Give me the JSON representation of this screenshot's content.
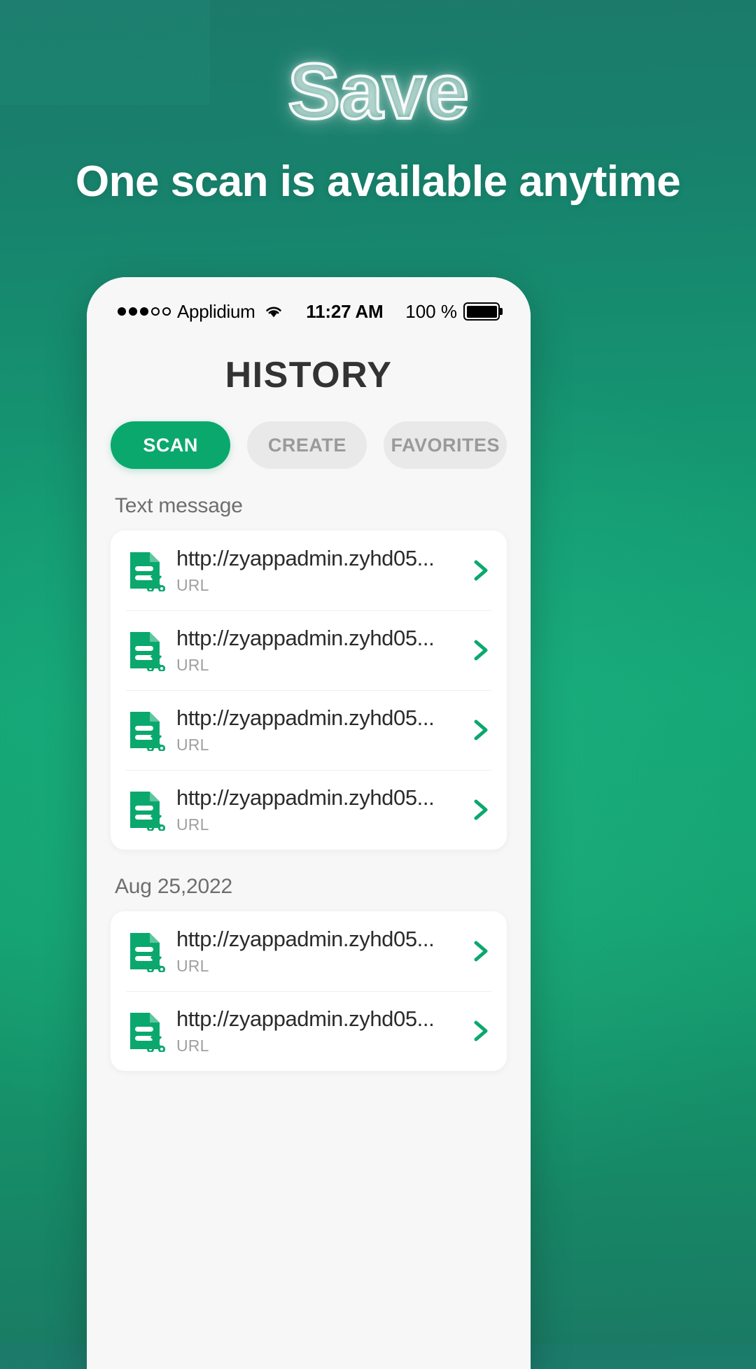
{
  "hero": {
    "title": "Save",
    "subtitle": "One scan is available anytime"
  },
  "colors": {
    "accent_green": "#0ba86e",
    "background_top": "#1c7a6b",
    "background_mid": "#13a474",
    "tab_inactive_bg": "#e9e9e9",
    "tab_inactive_text": "#9a9a9a",
    "screen_bg": "#f7f7f7",
    "title_text": "#333333"
  },
  "phone": {
    "status_bar": {
      "signal_dots_filled": 3,
      "signal_dots_empty": 2,
      "carrier": "Applidium",
      "wifi_icon": "wifi-icon",
      "time": "11:27 AM",
      "battery_percent": "100 %",
      "battery_icon": "battery-full-icon"
    },
    "nav_title": "HISTORY",
    "tabs": [
      {
        "label": "SCAN",
        "active": true
      },
      {
        "label": "CREATE",
        "active": false
      },
      {
        "label": "FAVORITES",
        "active": false
      }
    ],
    "sections": [
      {
        "header": "Text message",
        "items": [
          {
            "title": "http://zyappadmin.zyhd05...",
            "subtitle": "URL",
            "icon": "document-scissors-icon",
            "chevron": "chevron-right-icon"
          },
          {
            "title": "http://zyappadmin.zyhd05...",
            "subtitle": "URL",
            "icon": "document-scissors-icon",
            "chevron": "chevron-right-icon"
          },
          {
            "title": "http://zyappadmin.zyhd05...",
            "subtitle": "URL",
            "icon": "document-scissors-icon",
            "chevron": "chevron-right-icon"
          },
          {
            "title": "http://zyappadmin.zyhd05...",
            "subtitle": "URL",
            "icon": "document-scissors-icon",
            "chevron": "chevron-right-icon"
          }
        ]
      },
      {
        "header": "Aug 25,2022",
        "items": [
          {
            "title": "http://zyappadmin.zyhd05...",
            "subtitle": "URL",
            "icon": "document-scissors-icon",
            "chevron": "chevron-right-icon"
          },
          {
            "title": "http://zyappadmin.zyhd05...",
            "subtitle": "URL",
            "icon": "document-scissors-icon",
            "chevron": "chevron-right-icon"
          }
        ]
      }
    ]
  }
}
